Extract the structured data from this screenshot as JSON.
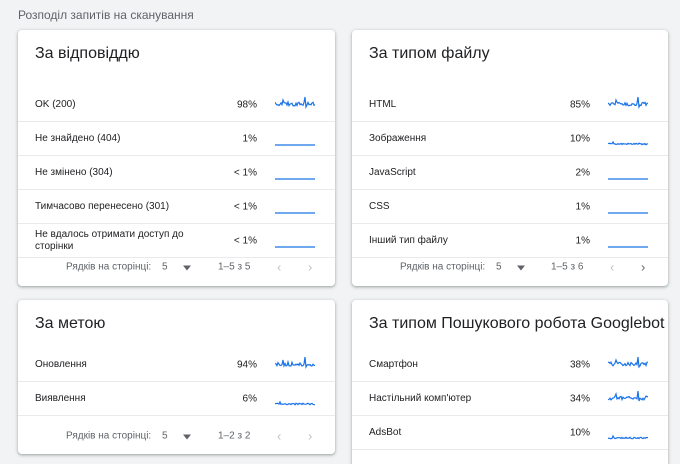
{
  "section_title": "Розподіл запитів на сканування",
  "colors": {
    "accent": "#1a73e8",
    "divider": "#e8eaed",
    "muted": "#5f6368"
  },
  "cards": [
    {
      "title": "За відповіддю",
      "rows": [
        {
          "label": "OK (200)",
          "pct": "98%",
          "spark": "high"
        },
        {
          "label": "Не знайдено (404)",
          "pct": "1%",
          "spark": "flat"
        },
        {
          "label": "Не змінено (304)",
          "pct": "< 1%",
          "spark": "flat"
        },
        {
          "label": "Тимчасово перенесено (301)",
          "pct": "< 1%",
          "spark": "flat"
        },
        {
          "label": "Не вдалось отримати доступ до сторінки",
          "pct": "< 1%",
          "spark": "flat"
        }
      ],
      "pager": {
        "rows_per_page_label": "Рядків на сторінці:",
        "rows_per_page": "5",
        "range": "1–5 з 5",
        "prev": "‹",
        "next": "›"
      }
    },
    {
      "title": "За типом файлу",
      "rows": [
        {
          "label": "HTML",
          "pct": "85%",
          "spark": "high"
        },
        {
          "label": "Зображення",
          "pct": "10%",
          "spark": "low"
        },
        {
          "label": "JavaScript",
          "pct": "2%",
          "spark": "flat"
        },
        {
          "label": "CSS",
          "pct": "1%",
          "spark": "flat"
        },
        {
          "label": "Інший тип файлу",
          "pct": "1%",
          "spark": "flat"
        }
      ],
      "pager": {
        "rows_per_page_label": "Рядків на сторінці:",
        "rows_per_page": "5",
        "range": "1–5 з 6",
        "prev": "‹",
        "next": "›"
      }
    },
    {
      "title": "За метою",
      "rows": [
        {
          "label": "Оновлення",
          "pct": "94%",
          "spark": "high"
        },
        {
          "label": "Виявлення",
          "pct": "6%",
          "spark": "low"
        }
      ],
      "pager": {
        "rows_per_page_label": "Рядків на сторінці:",
        "rows_per_page": "5",
        "range": "1–2 з 2",
        "prev": "‹",
        "next": "›"
      }
    },
    {
      "title": "За типом Пошукового робота Googlebot",
      "rows": [
        {
          "label": "Смартфон",
          "pct": "38%",
          "spark": "high"
        },
        {
          "label": "Настільний комп'ютер",
          "pct": "34%",
          "spark": "high"
        },
        {
          "label": "AdsBot",
          "pct": "10%",
          "spark": "low"
        }
      ]
    }
  ]
}
